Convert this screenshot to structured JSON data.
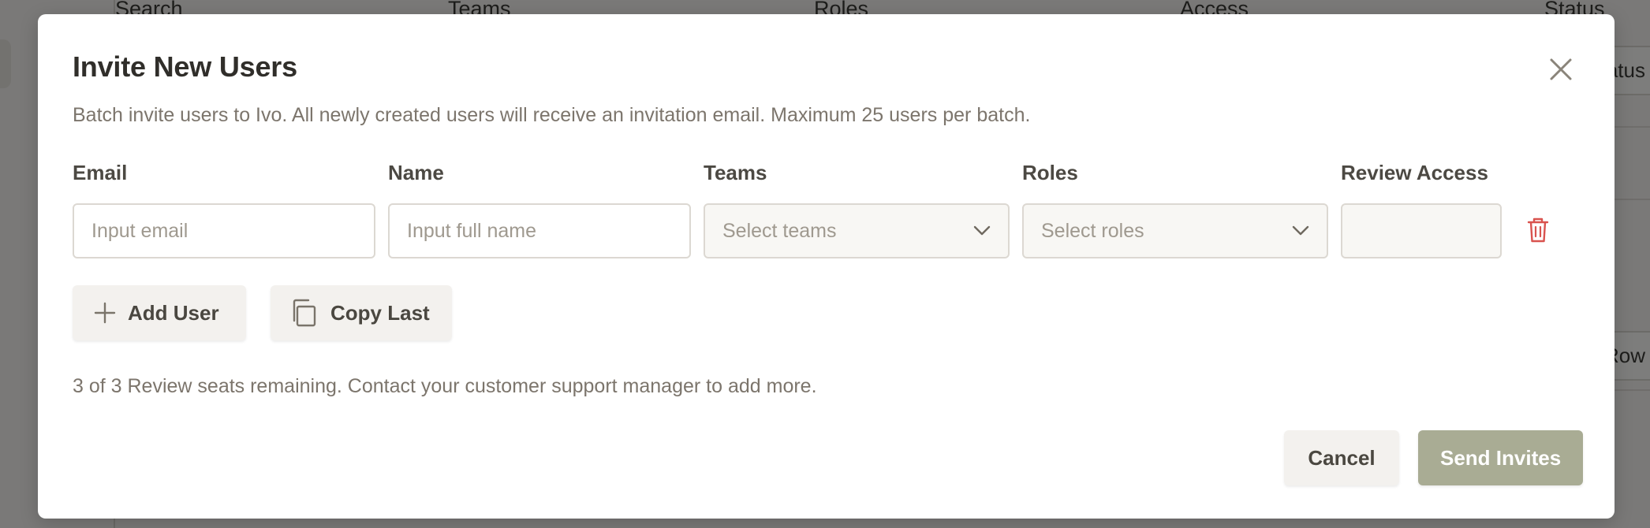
{
  "background": {
    "columns": [
      "Search",
      "Teams",
      "Roles",
      "Access",
      "Status"
    ],
    "right_buttons": [
      "Status",
      "Row"
    ]
  },
  "modal": {
    "title": "Invite New Users",
    "description": "Batch invite users to Ivo. All newly created users will receive an invitation email. Maximum 25 users per batch.",
    "fields": {
      "email": {
        "label": "Email",
        "placeholder": "Input email",
        "value": ""
      },
      "name": {
        "label": "Name",
        "placeholder": "Input full name",
        "value": ""
      },
      "teams": {
        "label": "Teams",
        "placeholder": "Select teams"
      },
      "roles": {
        "label": "Roles",
        "placeholder": "Select roles"
      },
      "review_access": {
        "label": "Review Access"
      }
    },
    "add_user_label": "Add User",
    "copy_last_label": "Copy Last",
    "seats_note": "3 of 3 Review seats remaining. Contact your customer support manager to add more.",
    "cancel_label": "Cancel",
    "send_label": "Send Invites"
  },
  "icons": {
    "close": "close-icon",
    "chevron": "chevron-down-icon",
    "trash": "trash-icon",
    "plus": "plus-icon",
    "copy": "copy-icon"
  },
  "colors": {
    "primary_button": "#a9ac94",
    "danger_icon": "#d9534f",
    "text_primary": "#302e2a",
    "text_muted": "#7c756c"
  }
}
